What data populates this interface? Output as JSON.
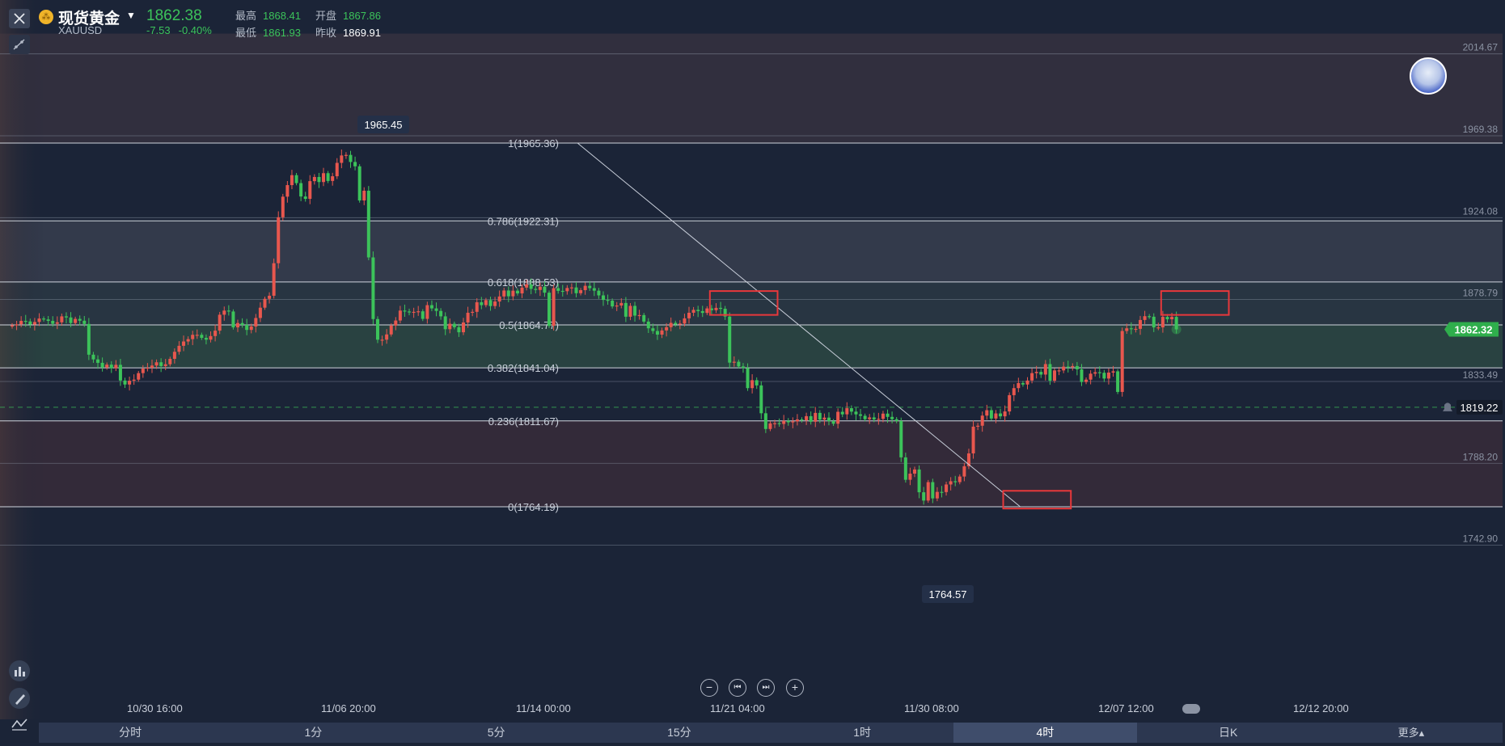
{
  "header": {
    "symbol_name": "现货黄金",
    "symbol_code": "XAUUSD",
    "price": "1862.38",
    "change": "-7.53",
    "change_pct": "-0.40%",
    "high_label": "最高",
    "high": "1868.41",
    "open_label": "开盘",
    "open": "1867.86",
    "low_label": "最低",
    "low": "1861.93",
    "prev_close_label": "昨收",
    "prev_close": "1869.91"
  },
  "date_axis": [
    "10/30 16:00",
    "11/06 20:00",
    "11/14 00:00",
    "11/21 04:00",
    "11/30 08:00",
    "12/07 12:00",
    "12/12 20:00"
  ],
  "timeframes": [
    {
      "label": "分时",
      "active": false
    },
    {
      "label": "1分",
      "active": false
    },
    {
      "label": "5分",
      "active": false
    },
    {
      "label": "15分",
      "active": false
    },
    {
      "label": "1时",
      "active": false
    },
    {
      "label": "4时",
      "active": true
    },
    {
      "label": "日K",
      "active": false
    },
    {
      "label": "更多▴",
      "active": false
    }
  ],
  "zoom_controls": [
    "−",
    "⏮",
    "⏭",
    "+"
  ],
  "icons": {
    "close": "close-icon",
    "draw": "draw-tool-icon",
    "indicators": "indicator-icon",
    "pen": "pen-icon",
    "compare": "compare-icon",
    "alert": "bell-icon",
    "link": "link-icon"
  },
  "colors": {
    "background": "#1b2437",
    "up": "#e8574e",
    "down": "#3cc35a",
    "fib_line": "#cfd4dc",
    "highlight_box": "#e8383b"
  },
  "chart_data": {
    "type": "candlestick",
    "symbol": "XAUUSD",
    "interval": "4时",
    "y_ticks": [
      "2014.67",
      "1969.38",
      "1924.08",
      "1878.79",
      "1833.49",
      "1788.20",
      "1742.90"
    ],
    "y_range": [
      1720,
      2025
    ],
    "current_price_label": "1862.32",
    "alert_price_label": "1819.22",
    "high_marker": "1965.45",
    "low_marker": "1764.57",
    "fibonacci": [
      {
        "label": "1(1965.36)",
        "value": 1965.36
      },
      {
        "label": "0.786(1922.31)",
        "value": 1922.31
      },
      {
        "label": "0.618(1888.53)",
        "value": 1888.53
      },
      {
        "label": "0.5(1864.77)",
        "value": 1864.77
      },
      {
        "label": "0.382(1841.04)",
        "value": 1841.04
      },
      {
        "label": "0.236(1811.67)",
        "value": 1811.67
      },
      {
        "label": "0(1764.19)",
        "value": 1764.19
      }
    ],
    "trend_line": {
      "from_index": 83,
      "from_value": 1965.36,
      "to_index": 189,
      "to_value": 1764.19
    },
    "highlight_boxes": [
      {
        "from_index": 110,
        "to_index": 125,
        "low": 1870.3,
        "high": 1883.5
      },
      {
        "from_index": 175,
        "to_index": 190,
        "low": 1763.2,
        "high": 1773.0
      },
      {
        "from_index": 210,
        "to_index": 225,
        "low": 1870.3,
        "high": 1883.5
      }
    ],
    "closes": [
      1864.5,
      1865.1,
      1867.0,
      1866.7,
      1865.0,
      1866.4,
      1868.3,
      1867.8,
      1867.0,
      1865.4,
      1866.2,
      1869.5,
      1868.9,
      1865.8,
      1868.1,
      1867.1,
      1865.3,
      1848.3,
      1845.7,
      1843.8,
      1841.2,
      1842.8,
      1840.8,
      1842.7,
      1834.0,
      1831.8,
      1833.9,
      1834.5,
      1838.1,
      1840.6,
      1841.1,
      1842.3,
      1844.1,
      1842.0,
      1843.0,
      1846.0,
      1849.9,
      1853.2,
      1855.6,
      1856.9,
      1859.3,
      1859.3,
      1857.6,
      1856.6,
      1858.6,
      1861.6,
      1870.4,
      1872.7,
      1872.2,
      1863.4,
      1865.8,
      1864.8,
      1862.0,
      1863.9,
      1868.6,
      1874.3,
      1879.2,
      1880.9,
      1898.9,
      1924.3,
      1935.7,
      1942.1,
      1947.6,
      1943.2,
      1935.8,
      1934.5,
      1944.3,
      1946.6,
      1943.8,
      1948.7,
      1944.4,
      1947.0,
      1954.4,
      1958.5,
      1958.8,
      1954.9,
      1952.5,
      1933.6,
      1939.0,
      1902.1,
      1868.0,
      1856.6,
      1856.6,
      1859.5,
      1864.4,
      1867.2,
      1872.7,
      1872.2,
      1872.0,
      1872.0,
      1872.3,
      1868.1,
      1875.7,
      1873.9,
      1872.5,
      1869.5,
      1862.4,
      1865.4,
      1863.5,
      1860.7,
      1866.1,
      1871.5,
      1872.0,
      1877.3,
      1875.7,
      1878.5,
      1875.2,
      1877.7,
      1880.5,
      1883.8,
      1880.6,
      1883.7,
      1882.2,
      1885.4,
      1887.2,
      1884.7,
      1884.1,
      1885.9,
      1882.6,
      1864.3,
      1885.1,
      1883.6,
      1883.4,
      1885.2,
      1885.5,
      1882.3,
      1884.0,
      1886.4,
      1885.1,
      1883.7,
      1881.1,
      1878.6,
      1878.2,
      1875.0,
      1875.5,
      1876.9,
      1869.3,
      1875.3,
      1869.9,
      1870.2,
      1866.6,
      1862.9,
      1861.4,
      1859.4,
      1861.7,
      1863.5,
      1865.9,
      1865.0,
      1865.5,
      1868.4,
      1871.5,
      1873.1,
      1872.4,
      1871.4,
      1873.9,
      1872.9,
      1874.2,
      1873.7,
      1869.4,
      1843.9,
      1844.4,
      1841.8,
      1840.9,
      1829.8,
      1834.2,
      1831.3,
      1815.9,
      1807.2,
      1810.3,
      1810.4,
      1810.0,
      1811.7,
      1810.9,
      1811.4,
      1812.5,
      1812.0,
      1814.3,
      1811.2,
      1816.1,
      1812.4,
      1813.5,
      1811.5,
      1810.1,
      1816.7,
      1815.3,
      1818.7,
      1816.8,
      1815.3,
      1814.5,
      1812.6,
      1813.6,
      1812.5,
      1812.8,
      1815.7,
      1813.9,
      1812.6,
      1811.6,
      1791.5,
      1779.1,
      1782.5,
      1784.8,
      1772.2,
      1767.6,
      1777.8,
      1768.8,
      1772.4,
      1772.3,
      1776.5,
      1778.3,
      1777.8,
      1780.9,
      1786.6,
      1793.7,
      1808.5,
      1809.0,
      1814.6,
      1817.6,
      1813.0,
      1815.8,
      1814.2,
      1816.9,
      1825.9,
      1829.8,
      1832.6,
      1831.8,
      1834.0,
      1838.1,
      1838.8,
      1837.3,
      1843.1,
      1833.9,
      1839.6,
      1839.6,
      1841.7,
      1841.4,
      1842.0,
      1840.2,
      1833.2,
      1834.5,
      1837.8,
      1838.6,
      1838.3,
      1835.1,
      1838.4,
      1839.1,
      1827.7,
      1861.4,
      1862.9,
      1862.5,
      1862.6,
      1867.5,
      1869.6,
      1869.3,
      1863.4,
      1863.4,
      1869.2,
      1867.9,
      1869.2,
      1862.3
    ]
  }
}
